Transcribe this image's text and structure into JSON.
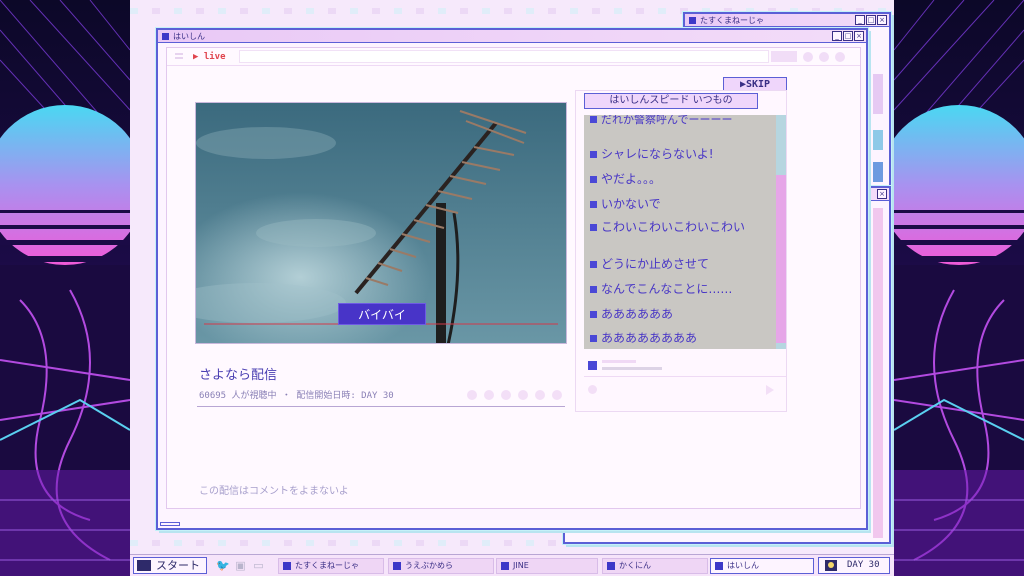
{
  "windows": {
    "back": {
      "title": "たすくまねーじゃ"
    },
    "main": {
      "title": "はいしん",
      "address": "▶ live"
    }
  },
  "stream": {
    "skip_label": "▶SKIP",
    "caption": "バイバイ",
    "title": "さよなら配信",
    "meta": "60695 人が視聴中 ・ 配信開始日時: DAY 30",
    "footer_note": "この配信はコメントをよまないよ"
  },
  "chat": {
    "header": "はいしんスピード いつもの",
    "messages": [
      {
        "text": "だれか警察呼んでーーーー"
      },
      {
        "text": "シャレにならないよ!"
      },
      {
        "text": "やだよ。。。"
      },
      {
        "text": "いかないで"
      },
      {
        "text": "こわいこわいこわいこわい"
      },
      {
        "text": "どうにか止めさせて"
      },
      {
        "text": "なんでこんなことに……"
      },
      {
        "text": "ああああああ"
      },
      {
        "text": "ああああああああ"
      }
    ]
  },
  "taskbar": {
    "start_label": "スタート",
    "tasks": [
      {
        "label": "たすくまねーじゃ"
      },
      {
        "label": "うえぶかめら"
      },
      {
        "label": "JINE"
      },
      {
        "label": "かくにん"
      },
      {
        "label": "はいしん"
      }
    ],
    "day_label": "DAY 30"
  },
  "theme": {
    "accent": "#5b5fd6",
    "caption_bg": "#4834c8",
    "chat_text": "#4836c6",
    "live_red": "#e0444e"
  }
}
